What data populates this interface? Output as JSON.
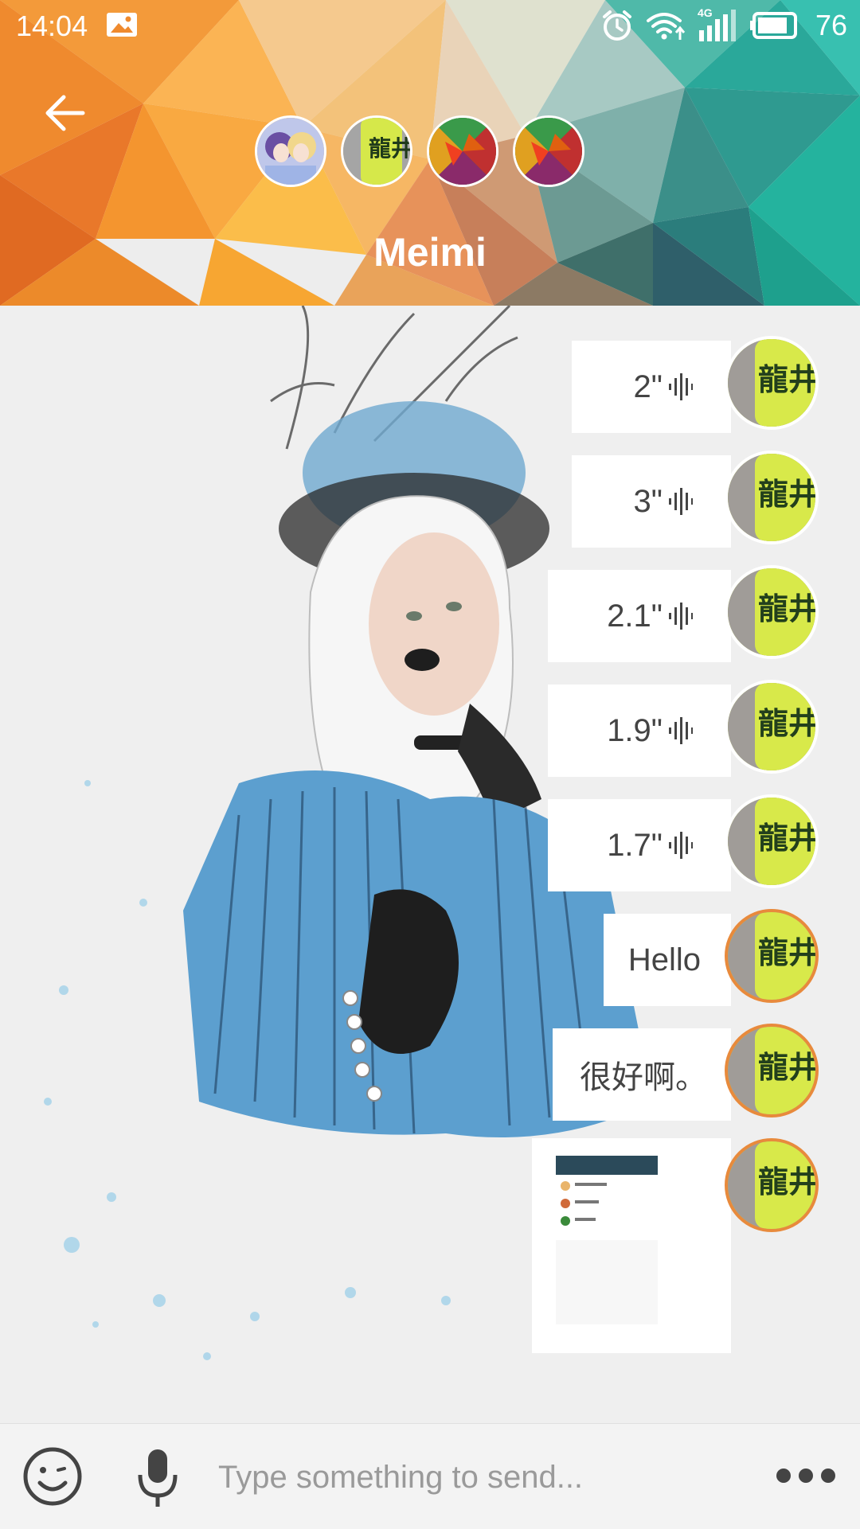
{
  "status_bar": {
    "time": "14:04",
    "network_type": "4G",
    "battery_level": "76",
    "icons": [
      "image-icon",
      "alarm-icon",
      "wifi-icon",
      "signal-icon",
      "battery-icon"
    ]
  },
  "header": {
    "back_icon": "back-arrow-icon",
    "title": "Meimi",
    "participants_count": 4
  },
  "messages": [
    {
      "type": "voice",
      "duration": "2\"",
      "icon": "voice-wave-icon",
      "avatar_ring": "white"
    },
    {
      "type": "voice",
      "duration": "3\"",
      "icon": "voice-wave-icon",
      "avatar_ring": "white"
    },
    {
      "type": "voice",
      "duration": "2.1\"",
      "icon": "voice-wave-icon",
      "avatar_ring": "white"
    },
    {
      "type": "voice",
      "duration": "1.9\"",
      "icon": "voice-wave-icon",
      "avatar_ring": "white"
    },
    {
      "type": "voice",
      "duration": "1.7\"",
      "icon": "voice-wave-icon",
      "avatar_ring": "white"
    },
    {
      "type": "text",
      "text": "Hello",
      "avatar_ring": "orange"
    },
    {
      "type": "text",
      "text": "很好啊。",
      "avatar_ring": "orange"
    },
    {
      "type": "image",
      "avatar_ring": "orange"
    }
  ],
  "input_bar": {
    "placeholder": "Type something to send...",
    "emoji_icon": "emoji-icon",
    "mic_icon": "microphone-icon",
    "more_icon": "more-dots-icon"
  },
  "colors": {
    "accent_ring": "#e88a3c",
    "bubble": "#ffffff",
    "background": "#eeeeee"
  }
}
